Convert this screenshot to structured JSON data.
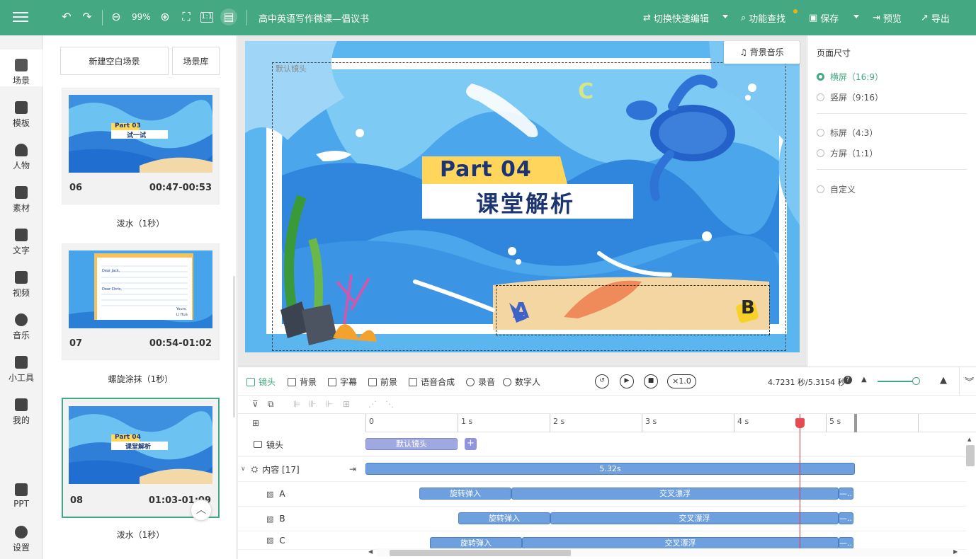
{
  "topbar": {
    "zoom": "99%",
    "title": "高中英语写作微课—倡议书",
    "quick_edit": "切换快速编辑",
    "find": "功能查找",
    "save": "保存",
    "preview": "预览",
    "export": "导出"
  },
  "sidebar": {
    "items": [
      {
        "label": "场景"
      },
      {
        "label": "模板"
      },
      {
        "label": "人物"
      },
      {
        "label": "素材"
      },
      {
        "label": "文字"
      },
      {
        "label": "视频"
      },
      {
        "label": "音乐"
      },
      {
        "label": "小工具"
      },
      {
        "label": "我的"
      },
      {
        "label": "PPT"
      },
      {
        "label": "设置"
      }
    ]
  },
  "scenes": {
    "new_blank": "新建空白场景",
    "library": "场景库",
    "cards": [
      {
        "num": "06",
        "time": "00:47-00:53",
        "transition": "泼水（1秒）",
        "part": "Part 03",
        "subtitle": "试一试"
      },
      {
        "num": "07",
        "time": "00:54-01:02",
        "transition": "螺旋涂抹（1秒）",
        "letter_lines": [
          "Dear Jack,",
          "Dear Chris,",
          "Yours,",
          "Li Hua"
        ]
      },
      {
        "num": "08",
        "time": "01:03-01:09",
        "transition": "泼水（1秒）",
        "part": "Part 04",
        "subtitle": "课堂解析"
      }
    ]
  },
  "stage": {
    "camera_label": "默认镜头",
    "bg_music": "背景音乐",
    "part_label": "Part 04",
    "main_title": "课堂解析",
    "letter_c": "C",
    "letter_a": "A",
    "letter_b": "B"
  },
  "page_size": {
    "title": "页面尺寸",
    "options": [
      {
        "label": "横屏（16:9）",
        "selected": true
      },
      {
        "label": "竖屏（9:16）"
      },
      {
        "label": "标屏（4:3）"
      },
      {
        "label": "方屏（1:1）"
      },
      {
        "label": "自定义"
      }
    ]
  },
  "timeline": {
    "tabs": [
      "镜头",
      "背景",
      "字幕",
      "前景",
      "语音合成",
      "录音",
      "数字人"
    ],
    "speed": "×1.0",
    "time": "4.7231 秒/5.3154 秒",
    "ruler": [
      "0",
      "1 s",
      "2 s",
      "3 s",
      "4 s",
      "5 s"
    ],
    "rows": {
      "camera": {
        "label": "镜头",
        "block": "默认镜头"
      },
      "content": {
        "label": "内容 [17]",
        "block": "5.32s"
      },
      "a": {
        "label": "A",
        "enter": "旋转弹入",
        "loop": "交叉漂浮",
        "end": "—..."
      },
      "b": {
        "label": "B",
        "enter": "旋转弹入",
        "loop": "交叉漂浮",
        "end": "—..."
      },
      "c": {
        "label": "C",
        "enter": "旋转弹入",
        "loop": "交叉漂浮",
        "end": "—..."
      }
    }
  },
  "colors": {
    "accent": "#44a882",
    "playhead": "#d9363e",
    "block": "#6ea0df",
    "camera_block": "#a0a8e2"
  }
}
